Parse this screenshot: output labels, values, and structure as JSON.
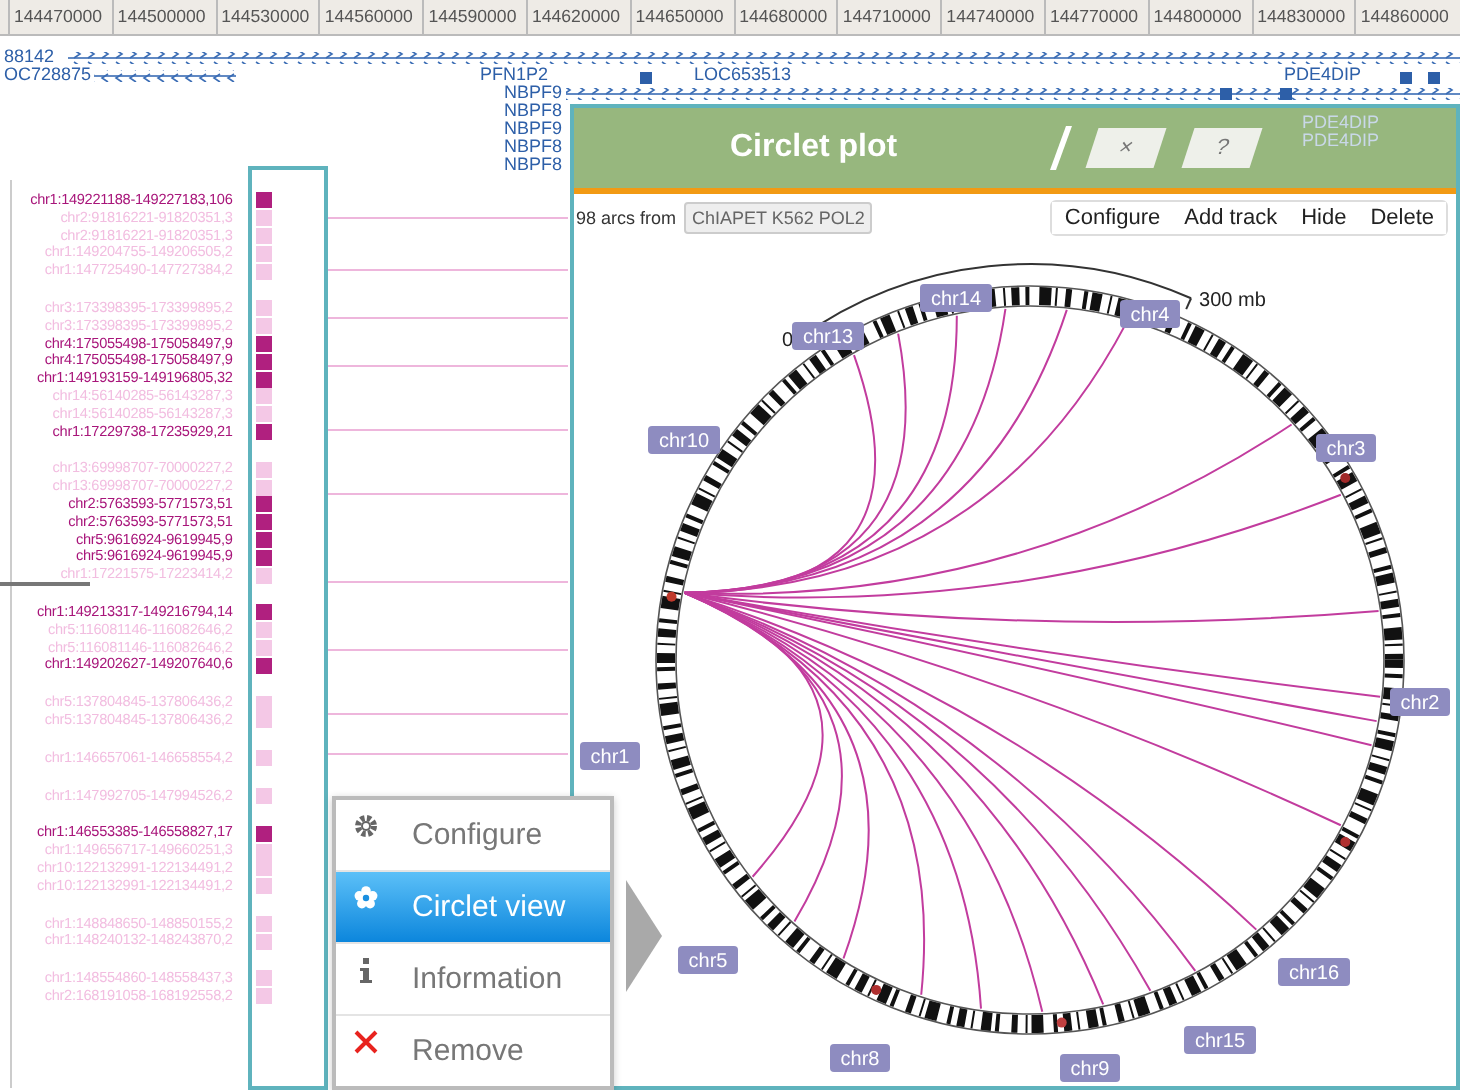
{
  "ruler": {
    "ticks": [
      "144470000",
      "144500000",
      "144530000",
      "144560000",
      "144590000",
      "144620000",
      "144650000",
      "144680000",
      "144710000",
      "144740000",
      "144770000",
      "144800000",
      "144830000",
      "144860000"
    ]
  },
  "genes": [
    "88142",
    "OC728875",
    "PFN1P2",
    "LOC653513",
    "PDE4DIP",
    "NBPF9",
    "NBPF8",
    "NBPF9",
    "NBPF8",
    "NBPF8",
    "PDE4DIP",
    "PDE4DIP"
  ],
  "interaction_groups": [
    [
      {
        "label": "chr1:149221188-149227183,106",
        "highlighted": true
      },
      {
        "label": "chr2:91816221-91820351,3",
        "highlighted": false
      },
      {
        "label": "chr2:91816221-91820351,3",
        "highlighted": false
      },
      {
        "label": "chr1:149204755-149206505,2",
        "highlighted": false
      },
      {
        "label": "chr1:147725490-147727384,2",
        "highlighted": false
      }
    ],
    [
      {
        "label": "chr3:173398395-173399895,2",
        "highlighted": false
      },
      {
        "label": "chr3:173398395-173399895,2",
        "highlighted": false
      },
      {
        "label": "chr4:175055498-175058497,9",
        "highlighted": true
      },
      {
        "label": "chr4:175055498-175058497,9",
        "highlighted": true
      },
      {
        "label": "chr1:149193159-149196805,32",
        "highlighted": true
      },
      {
        "label": "chr14:56140285-56143287,3",
        "highlighted": false
      },
      {
        "label": "chr14:56140285-56143287,3",
        "highlighted": false
      },
      {
        "label": "chr1:17229738-17235929,21",
        "highlighted": true
      }
    ],
    [
      {
        "label": "chr13:69998707-70000227,2",
        "highlighted": false
      },
      {
        "label": "chr13:69998707-70000227,2",
        "highlighted": false
      },
      {
        "label": "chr2:5763593-5771573,51",
        "highlighted": true
      },
      {
        "label": "chr2:5763593-5771573,51",
        "highlighted": true
      },
      {
        "label": "chr5:9616924-9619945,9",
        "highlighted": true
      },
      {
        "label": "chr5:9616924-9619945,9",
        "highlighted": true
      },
      {
        "label": "chr1:17221575-17223414,2",
        "highlighted": false
      }
    ],
    [
      {
        "label": "chr1:149213317-149216794,14",
        "highlighted": true
      },
      {
        "label": "chr5:116081146-116082646,2",
        "highlighted": false
      },
      {
        "label": "chr5:116081146-116082646,2",
        "highlighted": false
      },
      {
        "label": "chr1:149202627-149207640,6",
        "highlighted": true
      }
    ],
    [
      {
        "label": "chr5:137804845-137806436,2",
        "highlighted": false
      },
      {
        "label": "chr5:137804845-137806436,2",
        "highlighted": false
      }
    ],
    [
      {
        "label": "chr1:146657061-146658554,2",
        "highlighted": false
      }
    ],
    [
      {
        "label": "chr1:147992705-147994526,2",
        "highlighted": false
      }
    ],
    [
      {
        "label": "chr1:146553385-146558827,17",
        "highlighted": true
      },
      {
        "label": "chr1:149656717-149660251,3",
        "highlighted": false
      },
      {
        "label": "chr10:122132991-122134491,2",
        "highlighted": false
      },
      {
        "label": "chr10:122132991-122134491,2",
        "highlighted": false
      }
    ],
    [
      {
        "label": "chr1:148848650-148850155,2",
        "highlighted": false
      },
      {
        "label": "chr1:148240132-148243870,2",
        "highlighted": false
      }
    ],
    [
      {
        "label": "chr1:148554860-148558437,3",
        "highlighted": false
      },
      {
        "label": "chr2:168191058-168192558,2",
        "highlighted": false
      }
    ]
  ],
  "circlet": {
    "title": "Circlet plot",
    "close_button": "×",
    "help_button": "?",
    "arcs_text": "98 arcs from",
    "source": "ChIAPET K562 POL2",
    "toolbar": [
      "Configure",
      "Add track",
      "Hide",
      "Delete"
    ],
    "scale": {
      "start": "0",
      "end": "300 mb"
    },
    "chromosomes": [
      "chr13",
      "chr14",
      "chr4",
      "chr10",
      "chr3",
      "chr2",
      "chr1",
      "chr5",
      "chr16",
      "chr15",
      "chr8",
      "chr9"
    ]
  },
  "context_menu": [
    {
      "label": "Configure",
      "selected": false
    },
    {
      "label": "Circlet view",
      "selected": true
    },
    {
      "label": "Information",
      "selected": false
    },
    {
      "label": "Remove",
      "selected": false
    }
  ]
}
